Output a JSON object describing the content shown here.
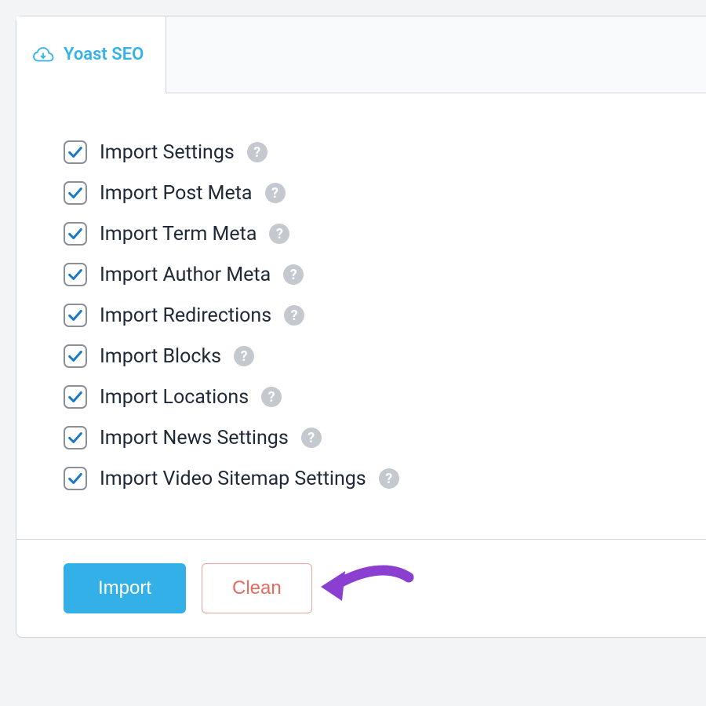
{
  "tab": {
    "label": "Yoast SEO"
  },
  "options": [
    {
      "label": "Import Settings",
      "checked": true
    },
    {
      "label": "Import Post Meta",
      "checked": true
    },
    {
      "label": "Import Term Meta",
      "checked": true
    },
    {
      "label": "Import Author Meta",
      "checked": true
    },
    {
      "label": "Import Redirections",
      "checked": true
    },
    {
      "label": "Import Blocks",
      "checked": true
    },
    {
      "label": "Import Locations",
      "checked": true
    },
    {
      "label": "Import News Settings",
      "checked": true
    },
    {
      "label": "Import Video Sitemap Settings",
      "checked": true
    }
  ],
  "buttons": {
    "import": "Import",
    "clean": "Clean"
  },
  "colors": {
    "accent": "#33b2e8",
    "danger": "#e96a5e",
    "arrow": "#8a3fd1"
  }
}
